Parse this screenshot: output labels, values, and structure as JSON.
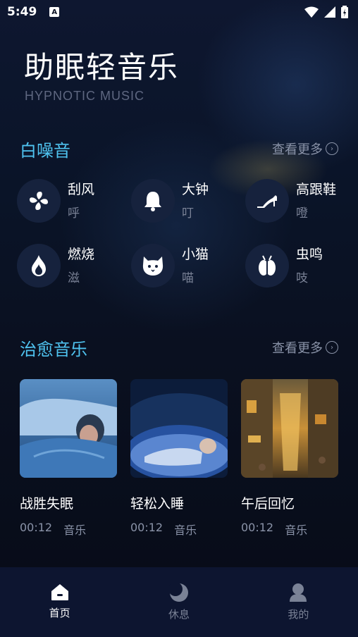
{
  "status": {
    "time": "5:49",
    "notif_letter": "A"
  },
  "header": {
    "title": "助眠轻音乐",
    "subtitle": "HYPNOTIC MUSIC"
  },
  "white_noise": {
    "title": "白噪音",
    "more": "查看更多",
    "items": [
      {
        "name": "刮风",
        "sound": "呼",
        "icon": "fan-icon"
      },
      {
        "name": "大钟",
        "sound": "叮",
        "icon": "bell-icon"
      },
      {
        "name": "高跟鞋",
        "sound": "噔",
        "icon": "high-heel-icon"
      },
      {
        "name": "燃烧",
        "sound": "滋",
        "icon": "flame-icon"
      },
      {
        "name": "小猫",
        "sound": "喵",
        "icon": "cat-icon"
      },
      {
        "name": "虫鸣",
        "sound": "吱",
        "icon": "bug-icon"
      }
    ]
  },
  "healing_music": {
    "title": "治愈音乐",
    "more": "查看更多",
    "cards": [
      {
        "title": "战胜失眠",
        "duration": "00:12",
        "type": "音乐"
      },
      {
        "title": "轻松入睡",
        "duration": "00:12",
        "type": "音乐"
      },
      {
        "title": "午后回忆",
        "duration": "00:12",
        "type": "音乐"
      }
    ]
  },
  "tabs": [
    {
      "label": "首页",
      "icon": "home-icon",
      "active": true
    },
    {
      "label": "休息",
      "icon": "moon-icon",
      "active": false
    },
    {
      "label": "我的",
      "icon": "profile-icon",
      "active": false
    }
  ],
  "colors": {
    "accent": "#4fc3f0",
    "background": "#0b1224",
    "tabbar": "#0d1530"
  }
}
